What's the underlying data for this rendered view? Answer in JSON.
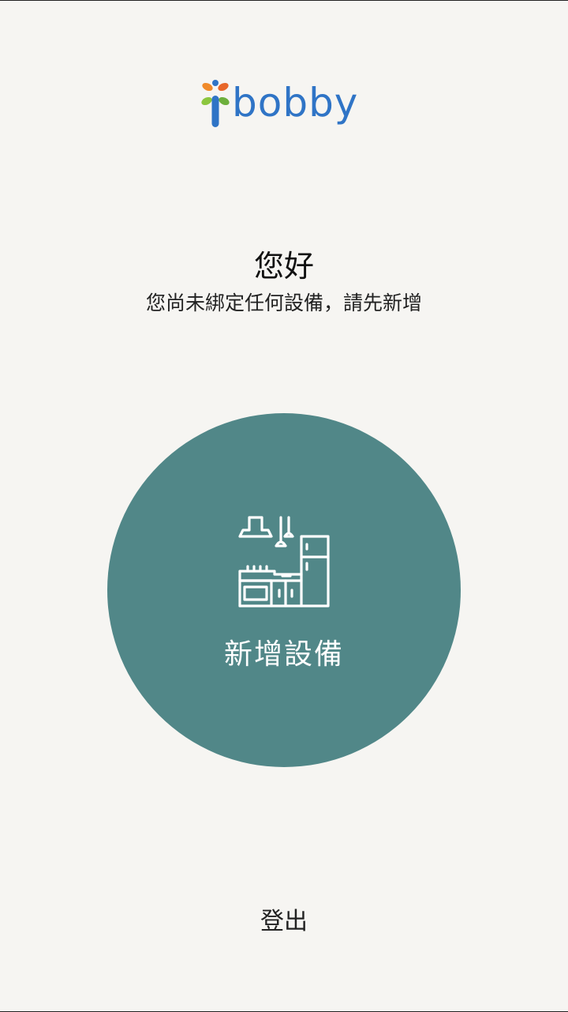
{
  "brand": {
    "logo_icon": "bobby-flower-icon",
    "logo_text": "bobby",
    "logo_color": "#2F74C6",
    "petal_colors": [
      "#F08A2A",
      "#E8672A",
      "#8CC63E",
      "#6DAF3C"
    ]
  },
  "welcome": {
    "title": "您好",
    "message": "您尚未綁定任何設備，請先新增"
  },
  "add_device": {
    "icon": "kitchen-appliances-icon",
    "label": "新增設備",
    "color": "#518788"
  },
  "footer": {
    "logout_label": "登出"
  },
  "theme": {
    "background": "#F6F5F2"
  }
}
